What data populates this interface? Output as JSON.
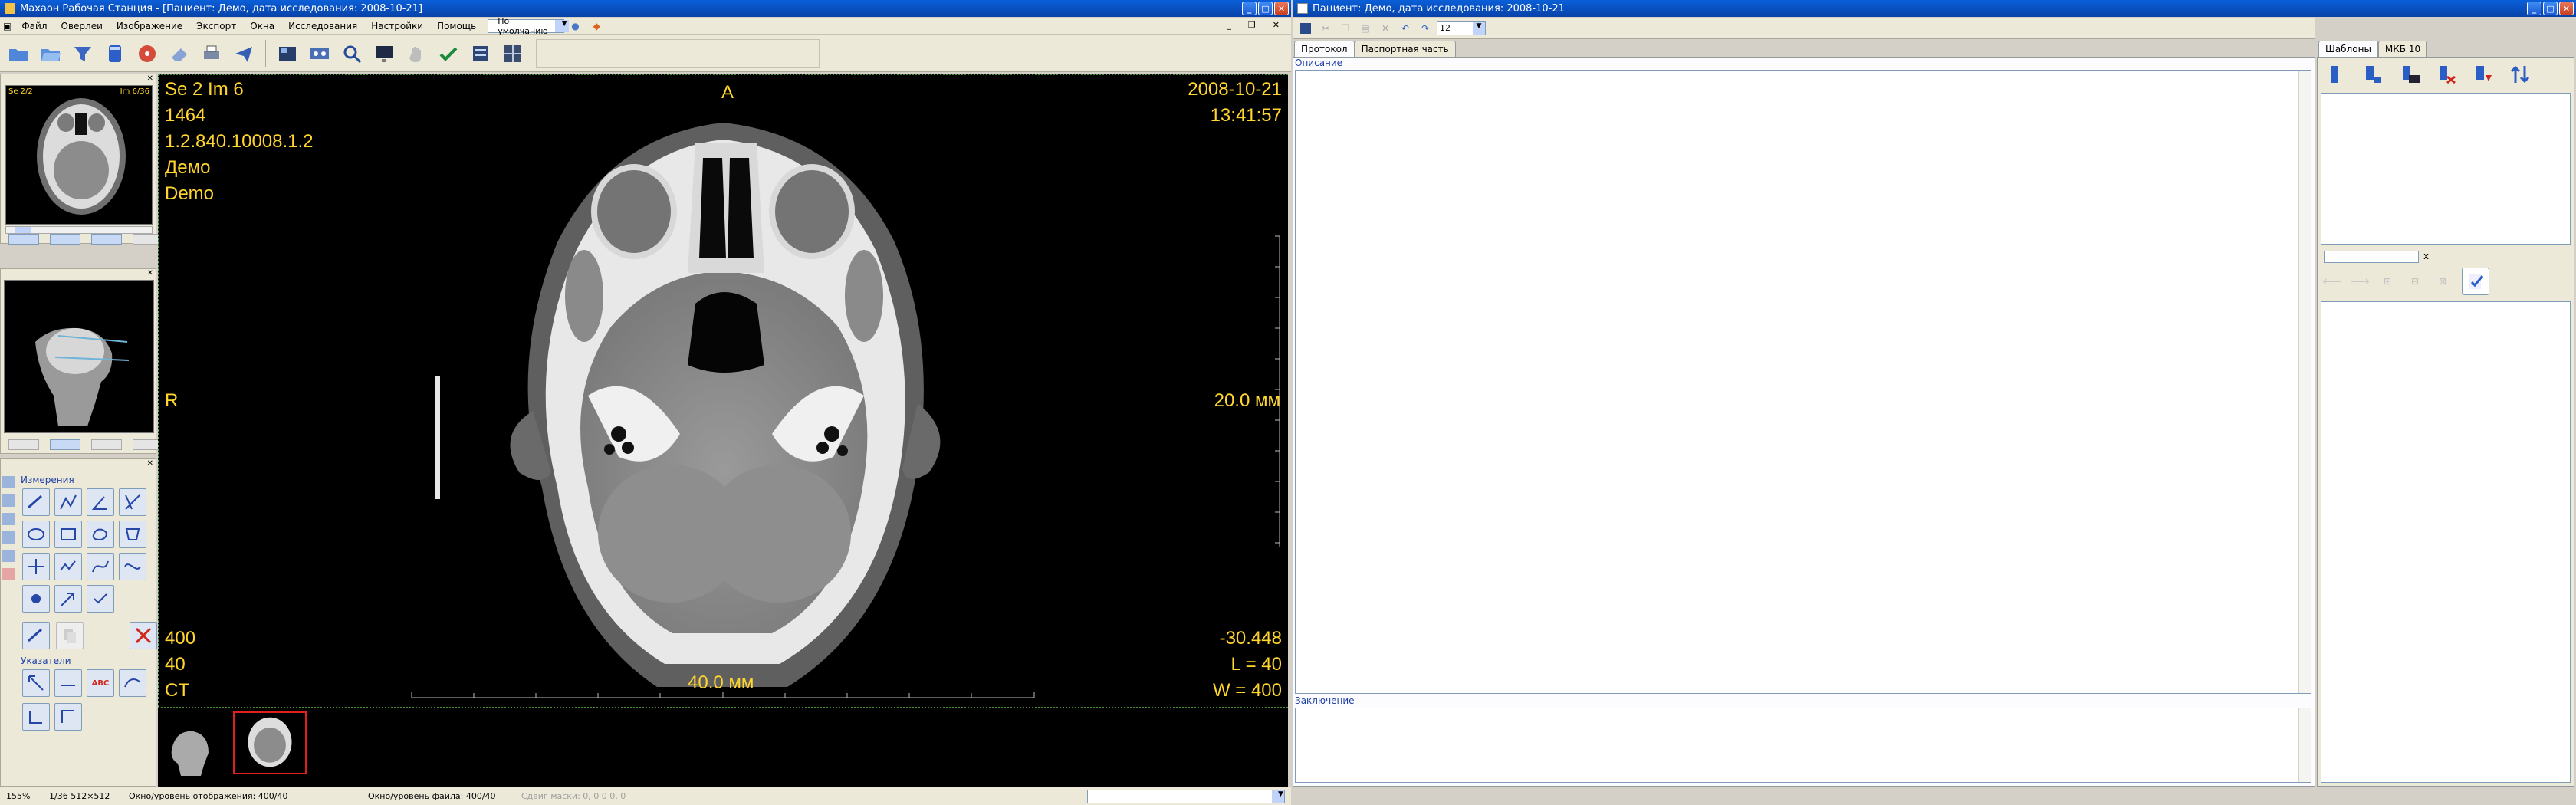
{
  "left_window": {
    "title": "Махаон Рабочая Станция - [Пациент: Демо, дата исследования: 2008-10-21]",
    "menu": [
      "Файл",
      "Оверлеи",
      "Изображение",
      "Экспорт",
      "Окна",
      "Исследования",
      "Настройки",
      "Помощь"
    ],
    "preset_select": "По умолчанию"
  },
  "series_panel": {
    "thumb1_label_left": "Se 2/2",
    "thumb1_label_right": "Im 6/36"
  },
  "measure_panel": {
    "title": "Измерения",
    "pointers_title": "Указатели",
    "abc_label": "ABC"
  },
  "viewer": {
    "tl": [
      "Se 2 Im 6",
      "1464",
      "1.2.840.10008.1.2",
      "Демо",
      "Demo"
    ],
    "tr": [
      "2008-10-21",
      "13:41:57"
    ],
    "top_center": "A",
    "left_mid": "R",
    "right_mid": "20.0 мм",
    "bl": [
      "400",
      "40",
      "CT"
    ],
    "br": [
      "-30.448",
      "L = 40",
      "W = 400"
    ],
    "bottom_center": "40.0 мм"
  },
  "status": {
    "zoom": "155%",
    "index": "1/36 512×512",
    "window_display": "Окно/уровень отображения: 400/40",
    "window_file": "Окно/уровень файла: 400/40",
    "greyed": "Сдвиг маски: 0, 0 0 0, 0"
  },
  "right_window": {
    "title": "Пациент: Демо, дата исследования: 2008-10-21",
    "font_size": "12",
    "tabs": [
      "Протокол",
      "Паспортная часть"
    ],
    "description_label": "Описание",
    "conclusion_label": "Заключение",
    "side_tabs": [
      "Шаблоны",
      "МКБ 10"
    ],
    "search_clear": "x"
  },
  "colors": {
    "overlay": "#ffd52e",
    "title_bar": "#0a5fd8",
    "chrome": "#ece9d8"
  }
}
